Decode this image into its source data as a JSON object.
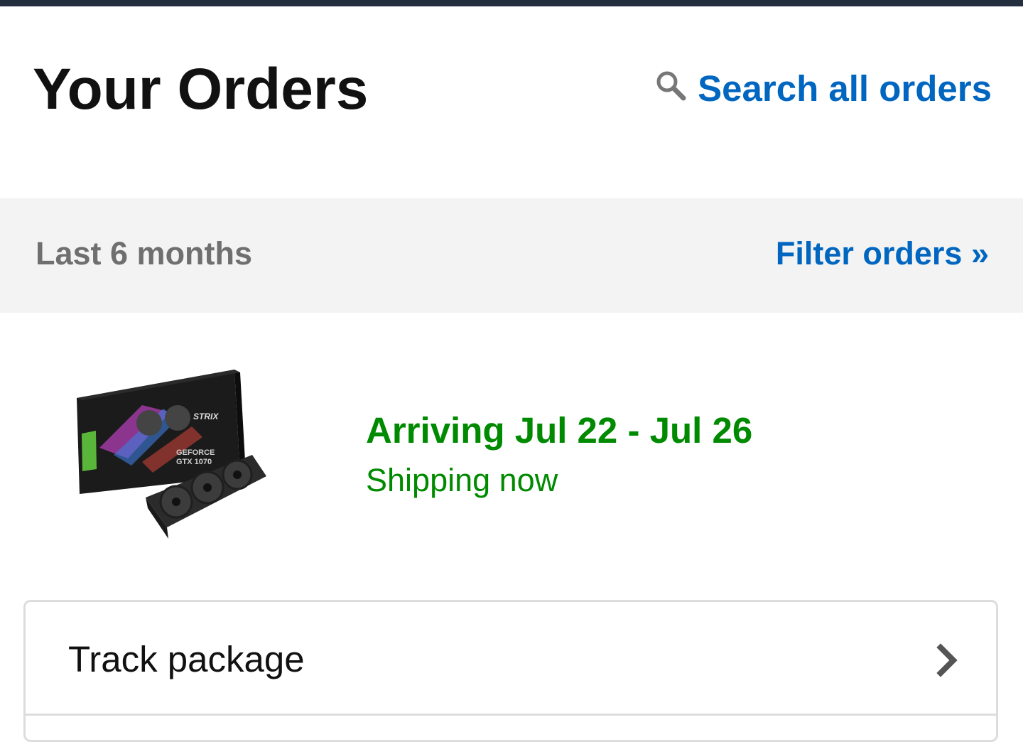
{
  "header": {
    "title": "Your Orders",
    "search_label": "Search all orders",
    "search_icon": "search-icon"
  },
  "filter_bar": {
    "period": "Last 6 months",
    "filter_label": "Filter orders »"
  },
  "order": {
    "image": "graphics-card-box-image",
    "image_text": [
      "STRIX",
      "GEFORCE",
      "GTX 1070"
    ],
    "delivery_title": "Arriving Jul 22 - Jul 26",
    "delivery_status": "Shipping now"
  },
  "actions": [
    {
      "label": "Track package",
      "icon": "chevron-right-icon"
    }
  ],
  "colors": {
    "top_bar": "#232f3e",
    "link": "#0066c0",
    "delivery": "#008a00",
    "filter_bg": "#f3f3f3",
    "muted_text": "#6f6f6f"
  }
}
